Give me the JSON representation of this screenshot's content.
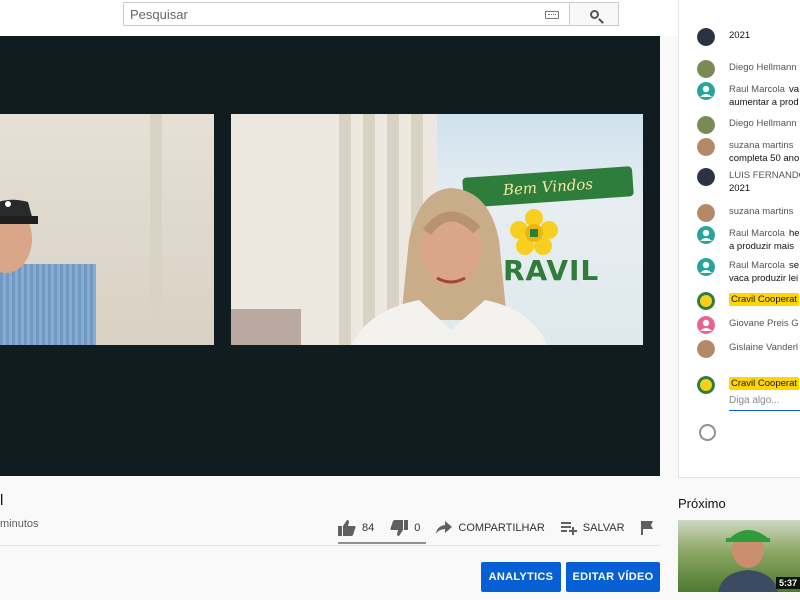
{
  "search": {
    "placeholder": "Pesquisar"
  },
  "video": {
    "title_fragment": "l",
    "meta_fragment": "minutos",
    "banner_welcome": "Bem Vindos",
    "banner_brand": "RAVIL"
  },
  "actions": {
    "likes": "84",
    "dislikes": "0",
    "share_label": "COMPARTILHAR",
    "save_label": "SALVAR",
    "like_ratio": 1.0
  },
  "owner_buttons": {
    "analytics": "ANALYTICS",
    "edit": "EDITAR VÍDEO"
  },
  "chat": {
    "messages": [
      {
        "author": "",
        "text": "2021",
        "avatar": "dark-photo"
      },
      {
        "author": "Diego Hellmann",
        "text": "",
        "avatar": "landscape-photo"
      },
      {
        "author": "Raul Marcola",
        "text": "va",
        "line2": "aumentar a prod",
        "avatar": "default-teal"
      },
      {
        "author": "Diego Hellmann",
        "text": "",
        "avatar": "landscape-photo"
      },
      {
        "author": "suzana martins",
        "text": "",
        "line2": "completa 50 ano",
        "avatar": "woman-photo"
      },
      {
        "author": "LUIS FERNANDO",
        "text": "",
        "line2": "2021",
        "avatar": "dark-photo"
      },
      {
        "author": "suzana martins",
        "text": "",
        "avatar": "woman-photo"
      },
      {
        "author": "Raul Marcola",
        "text": "he",
        "line2": "a produzir mais",
        "avatar": "default-teal"
      },
      {
        "author": "Raul Marcola",
        "text": "se",
        "line2": "vaca produzir lei",
        "avatar": "default-teal"
      },
      {
        "author": "Cravil Cooperat",
        "text": "",
        "avatar": "cravil-logo",
        "owner": true
      },
      {
        "author": "Giovane Preis G",
        "text": "",
        "avatar": "default-pink"
      },
      {
        "author": "Gislaine Vanderl",
        "text": "",
        "avatar": "woman-photo"
      }
    ],
    "input_author": "Cravil Cooperat",
    "input_placeholder": "Diga algo..."
  },
  "next": {
    "label": "Próximo",
    "duration": "5:37"
  },
  "colors": {
    "accent": "#065fd4",
    "owner_badge": "#ffd600",
    "video_bg": "#101c1f"
  }
}
